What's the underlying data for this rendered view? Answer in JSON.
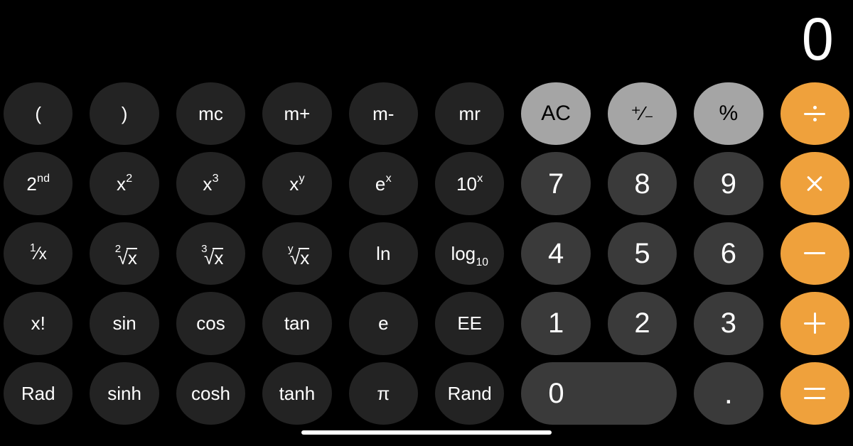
{
  "app": {
    "name": "Calculator",
    "mode": "scientific",
    "orientation": "landscape",
    "background_color": "#000000"
  },
  "display": {
    "value": "0"
  },
  "colors": {
    "background": "#000000",
    "function_key": "#232323",
    "number_key": "#3a3a3a",
    "utility_key": "#a5a5a5",
    "operator_key": "#efa13c",
    "key_text": "#ffffff",
    "utility_key_text": "#000000",
    "home_indicator": "#ffffff"
  },
  "keypad": {
    "rows": [
      [
        {
          "label": "(",
          "name": "open-paren",
          "style": "fn"
        },
        {
          "label": ")",
          "name": "close-paren",
          "style": "fn"
        },
        {
          "label": "mc",
          "name": "memory-clear",
          "style": "fn"
        },
        {
          "label": "m+",
          "name": "memory-add",
          "style": "fn"
        },
        {
          "label": "m-",
          "name": "memory-subtract",
          "style": "fn"
        },
        {
          "label": "mr",
          "name": "memory-recall",
          "style": "fn"
        },
        {
          "label": "AC",
          "name": "all-clear",
          "style": "util"
        },
        {
          "label": "+/-",
          "name": "sign-toggle",
          "style": "util"
        },
        {
          "label": "%",
          "name": "percent",
          "style": "util"
        },
        {
          "label": "÷",
          "name": "divide",
          "style": "op"
        }
      ],
      [
        {
          "label": "2nd",
          "name": "second-function",
          "style": "fn"
        },
        {
          "label": "x²",
          "name": "square",
          "style": "fn"
        },
        {
          "label": "x³",
          "name": "cube",
          "style": "fn"
        },
        {
          "label": "xʸ",
          "name": "power-y",
          "style": "fn"
        },
        {
          "label": "eˣ",
          "name": "exp-e",
          "style": "fn"
        },
        {
          "label": "10ˣ",
          "name": "exp-ten",
          "style": "fn"
        },
        {
          "label": "7",
          "name": "digit-7",
          "style": "num"
        },
        {
          "label": "8",
          "name": "digit-8",
          "style": "num"
        },
        {
          "label": "9",
          "name": "digit-9",
          "style": "num"
        },
        {
          "label": "×",
          "name": "multiply",
          "style": "op"
        }
      ],
      [
        {
          "label": "¹∕x",
          "name": "reciprocal",
          "style": "fn"
        },
        {
          "label": "²√x",
          "name": "square-root",
          "style": "fn"
        },
        {
          "label": "³√x",
          "name": "cube-root",
          "style": "fn"
        },
        {
          "label": "ʸ√x",
          "name": "y-root",
          "style": "fn"
        },
        {
          "label": "ln",
          "name": "natural-log",
          "style": "fn"
        },
        {
          "label": "log₁₀",
          "name": "log-base-ten",
          "style": "fn"
        },
        {
          "label": "4",
          "name": "digit-4",
          "style": "num"
        },
        {
          "label": "5",
          "name": "digit-5",
          "style": "num"
        },
        {
          "label": "6",
          "name": "digit-6",
          "style": "num"
        },
        {
          "label": "−",
          "name": "subtract",
          "style": "op"
        }
      ],
      [
        {
          "label": "x!",
          "name": "factorial",
          "style": "fn"
        },
        {
          "label": "sin",
          "name": "sine",
          "style": "fn"
        },
        {
          "label": "cos",
          "name": "cosine",
          "style": "fn"
        },
        {
          "label": "tan",
          "name": "tangent",
          "style": "fn"
        },
        {
          "label": "e",
          "name": "euler-constant",
          "style": "fn"
        },
        {
          "label": "EE",
          "name": "scientific-notation",
          "style": "fn"
        },
        {
          "label": "1",
          "name": "digit-1",
          "style": "num"
        },
        {
          "label": "2",
          "name": "digit-2",
          "style": "num"
        },
        {
          "label": "3",
          "name": "digit-3",
          "style": "num"
        },
        {
          "label": "+",
          "name": "add",
          "style": "op"
        }
      ],
      [
        {
          "label": "Rad",
          "name": "radian-toggle",
          "style": "fn"
        },
        {
          "label": "sinh",
          "name": "hyperbolic-sine",
          "style": "fn"
        },
        {
          "label": "cosh",
          "name": "hyperbolic-cosine",
          "style": "fn"
        },
        {
          "label": "tanh",
          "name": "hyperbolic-tangent",
          "style": "fn"
        },
        {
          "label": "π",
          "name": "pi-constant",
          "style": "fn"
        },
        {
          "label": "Rand",
          "name": "random",
          "style": "fn"
        },
        {
          "label": "0",
          "name": "digit-0",
          "style": "num zero"
        },
        {
          "label": ".",
          "name": "decimal-point",
          "style": "num dot"
        },
        {
          "label": "=",
          "name": "equals",
          "style": "op"
        }
      ]
    ]
  }
}
